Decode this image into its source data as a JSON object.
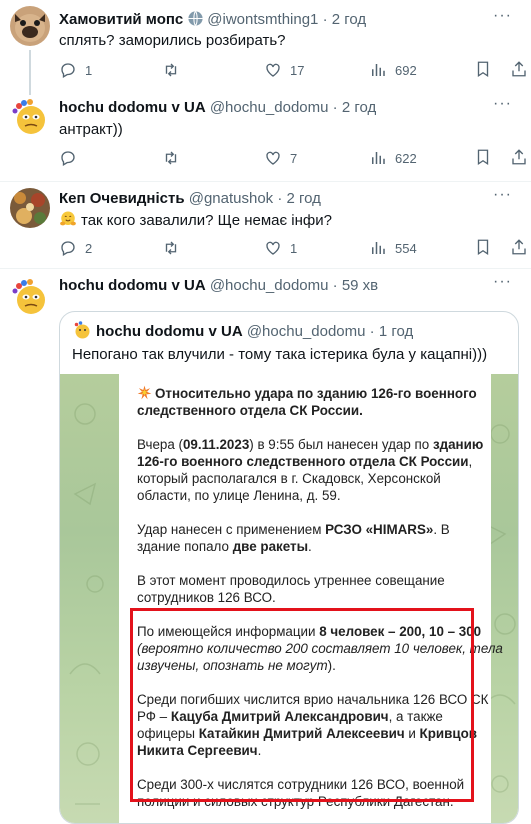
{
  "tweets": [
    {
      "name": "Хамовитий мопс",
      "handle": "@iwontsmthing1",
      "time": "2 год",
      "text": "сплять? заморились розбирать?",
      "replies": "1",
      "retweets": "",
      "likes": "17",
      "views": "692"
    },
    {
      "name": "hochu dodomu v UA",
      "handle": "@hochu_dodomu",
      "time": "2 год",
      "text": "антракт))",
      "replies": "",
      "retweets": "",
      "likes": "7",
      "views": "622"
    },
    {
      "name": "Кеп Очевидність",
      "handle": "@gnatushok",
      "time": "2 год",
      "text": "так кого завалили? Ще немає інфи?",
      "replies": "2",
      "retweets": "",
      "likes": "1",
      "views": "554"
    },
    {
      "name": "hochu dodomu v UA",
      "handle": "@hochu_dodomu",
      "time": "59 хв"
    }
  ],
  "separator": "·",
  "more_label": "···",
  "quote": {
    "name": "hochu dodomu v UA",
    "handle": "@hochu_dodomu",
    "time": "1 год",
    "text": "Непогано так влучили - тому така істерика була у кацапні)))"
  },
  "telegram": {
    "l1": "Относительно удара по зданию 126-го военного",
    "l2": "следственного отдела СК России.",
    "l3a": "Вчера (",
    "l3b": "09.11.2023",
    "l3c": ") в 9:55 был нанесен удар по ",
    "l3d": "зданию",
    "l4": "126-го военного следственного отдела СК России",
    "l4b": ",",
    "l5": "который располагался в г. Скадовск, Херсонской",
    "l6": "области, по улице Ленина, д. 59.",
    "l7a": "Удар нанесен с применением ",
    "l7b": "РСЗО «HIMARS»",
    "l7c": ". В",
    "l8a": "здание попало ",
    "l8b": "две ракеты",
    "l8c": ".",
    "l9": "В этот момент проводилось утреннее совещание",
    "l10": "сотрудников 126 ВСО.",
    "l11a": "По имеющейся информации ",
    "l11b": "8 человек – 200, 10 – 300",
    "l12": "(вероятно количество 200 составляет 10 человек, тела",
    "l13a": "извучены, опознать не могут",
    "l13b": ").",
    "l14": "Среди погибших числится врио начальника 126 ВСО СК",
    "l15a": "РФ – ",
    "l15b": "Кацуба Дмитрий Александрович",
    "l15c": ", а также",
    "l16a": "офицеры ",
    "l16b": "Катайкин Дмитрий Алексеевич",
    "l16c": " и ",
    "l16d": "Кривцов",
    "l17": "Никита Сергеевич",
    "l17b": ".",
    "l18": "Среди 300-х числятся сотрудники 126 ВСО, военной",
    "l19": "полиции и силовых структур Республики Дагестан."
  },
  "colors": {
    "text": "#0f1419",
    "muted": "#536471",
    "divider": "#eff3f4",
    "highlight_box": "#e3121b"
  },
  "icons": [
    "reply-icon",
    "retweet-icon",
    "like-icon",
    "views-icon",
    "bookmark-icon",
    "share-icon",
    "globe-icon",
    "collision-emoji",
    "hugging-emoji"
  ]
}
